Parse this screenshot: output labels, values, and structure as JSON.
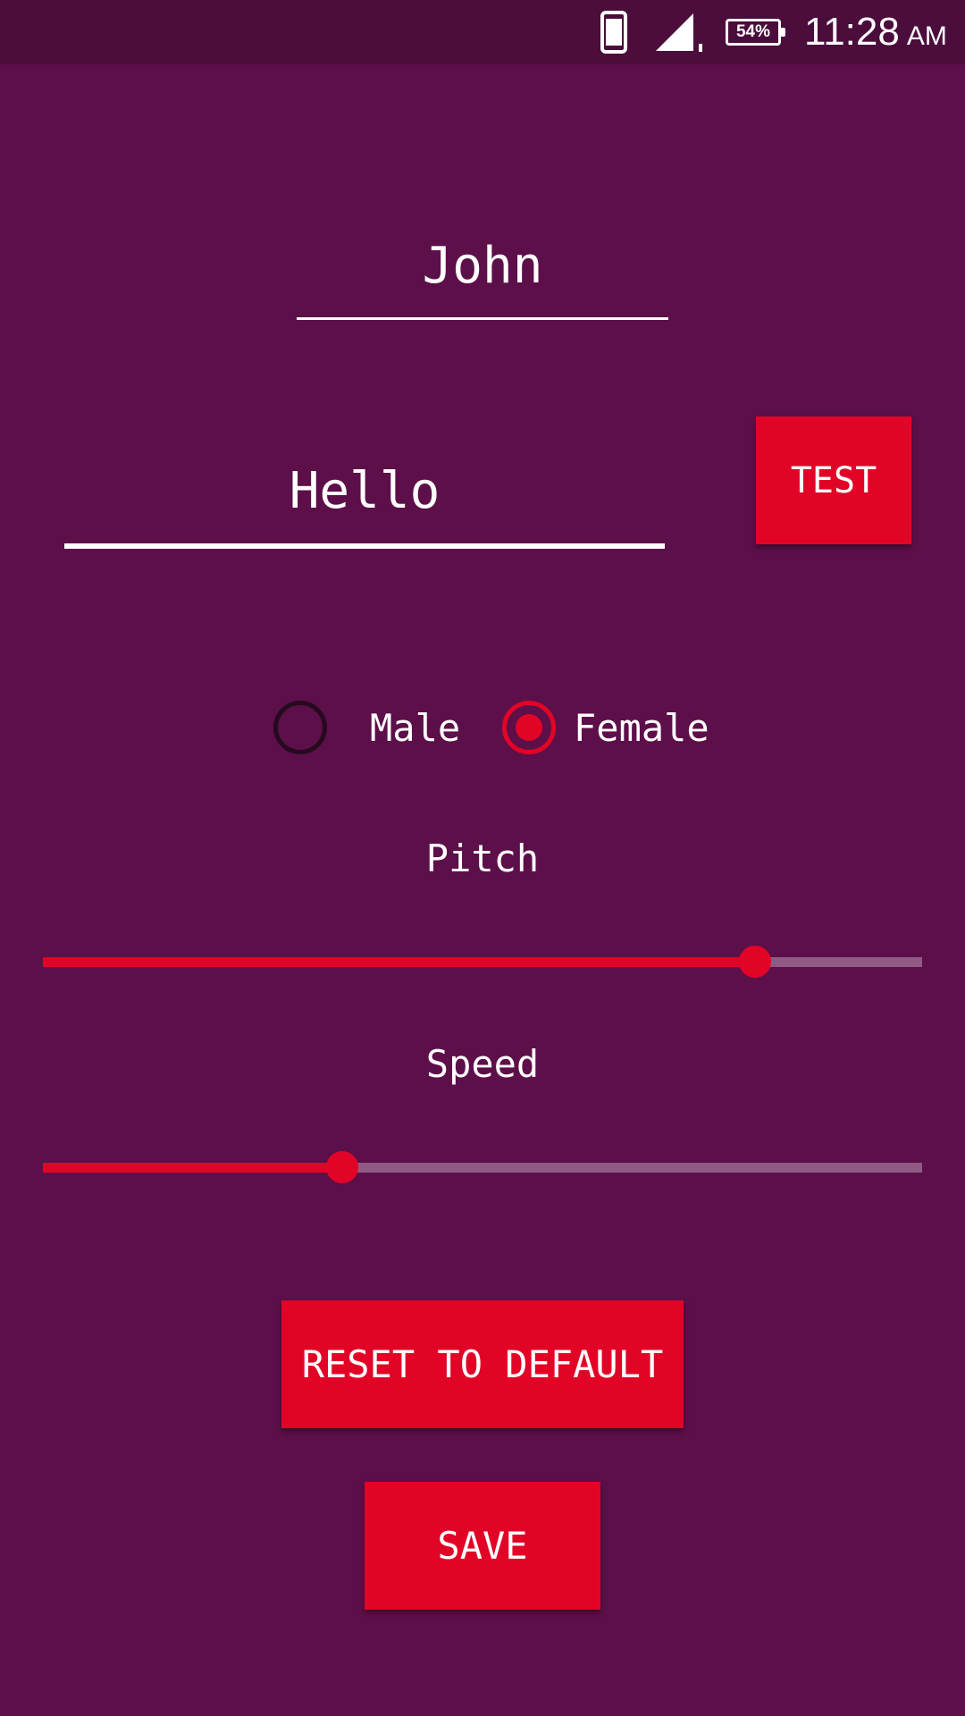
{
  "status_bar": {
    "battery": "54%",
    "time": "11:28",
    "ampm": "AM",
    "icons": [
      "phone-icon",
      "signal-icon",
      "battery-icon"
    ]
  },
  "form": {
    "name_value": "John",
    "message_value": "Hello",
    "test_label": "TEST"
  },
  "gender": {
    "options": [
      {
        "label": "Male",
        "selected": false
      },
      {
        "label": "Female",
        "selected": true
      }
    ]
  },
  "pitch": {
    "label": "Pitch",
    "value": 0.81
  },
  "speed": {
    "label": "Speed",
    "value": 0.34
  },
  "actions": {
    "reset_label": "RESET TO DEFAULT",
    "save_label": "SAVE"
  },
  "colors": {
    "background": "#5d0f49",
    "status_bar": "#4b0d3b",
    "accent": "#e20426",
    "track_inactive": "#8f5a83"
  }
}
